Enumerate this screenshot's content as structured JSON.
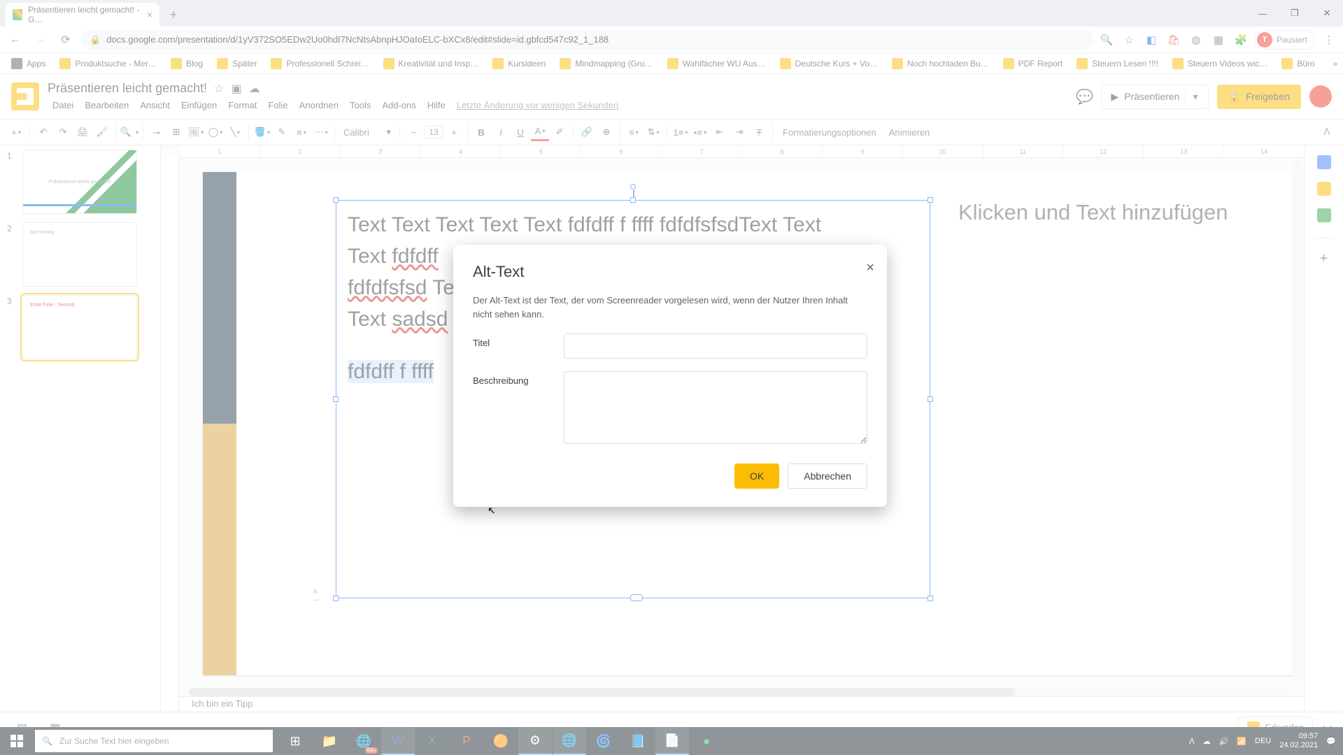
{
  "browser": {
    "tab_title": "Präsentieren leicht gemacht! - G…",
    "url": "docs.google.com/presentation/d/1yV372SO5EDw2Uo0hdI7NcNtsAbnpHJOaIoELC-bXCx8/edit#slide=id.gbfcd547c92_1_188",
    "profile_state": "Pausiert"
  },
  "bookmarks": [
    "Apps",
    "Produktsuche - Mer…",
    "Blog",
    "Später",
    "Professionell Schrei…",
    "Kreativität und Insp…",
    "Kursideen",
    "Mindmapping  (Gru…",
    "Wahlfächer WU Aus…",
    "Deutsche Kurs + Vo…",
    "Noch hochladen Bu…",
    "PDF Report",
    "Steuern Lesen !!!!",
    "Steuern Videos wic…",
    "Büro"
  ],
  "app": {
    "doc_title": "Präsentieren leicht gemacht!",
    "menus": [
      "Datei",
      "Bearbeiten",
      "Ansicht",
      "Einfügen",
      "Format",
      "Folie",
      "Anordnen",
      "Tools",
      "Add-ons",
      "Hilfe"
    ],
    "last_change": "Letzte Änderung vor wenigen Sekunden",
    "present": "Präsentieren",
    "share": "Freigeben"
  },
  "toolbar": {
    "font": "Calibri",
    "font_size": "13",
    "opt_layout": "Formatierungsoptionen",
    "opt_anim": "Animieren"
  },
  "ruler": [
    "1",
    "2",
    "3",
    "4",
    "5",
    "6",
    "7",
    "8",
    "9",
    "10",
    "11",
    "12",
    "13",
    "14"
  ],
  "thumbs": [
    {
      "n": "1",
      "caption": "Präsentieren leicht gemacht!"
    },
    {
      "n": "2",
      "caption": "abcmoving"
    },
    {
      "n": "3",
      "caption": "Erste Folie · Second"
    }
  ],
  "slide": {
    "line1": "Text Text Text Text Text fdfdff f ffff fdfdfsfsdText Text",
    "line2a": "Text ",
    "line2b": "fdfdff",
    "line3a": "fdfdfsfsd",
    "line3b": " Te",
    "line4a": "Text ",
    "line4b": "sadsd",
    "line5": "fdfdff f ffff",
    "placeholder": "Klicken und Text hinzufügen",
    "notes": "Ich bin ein Tipp"
  },
  "dialog": {
    "title": "Alt-Text",
    "desc": "Der Alt-Text ist der Text, der vom Screenreader vorgelesen wird, wenn der Nutzer Ihren Inhalt nicht sehen kann.",
    "label_title": "Titel",
    "label_desc": "Beschreibung",
    "ok": "OK",
    "cancel": "Abbrechen"
  },
  "footer": {
    "explore": "Erkunden"
  },
  "taskbar": {
    "search": "Zur Suche Text hier eingeben",
    "badge": "99+",
    "lang": "DEU",
    "time": "09:57",
    "date": "24.02.2021"
  }
}
